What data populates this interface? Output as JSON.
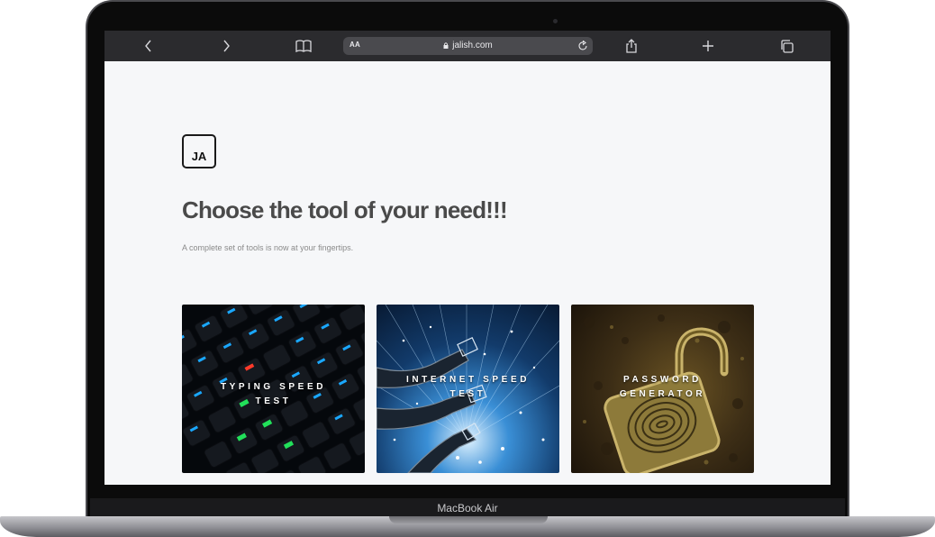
{
  "device": {
    "label": "MacBook Air"
  },
  "browser": {
    "text_size_button": "AA",
    "url": "jalish.com",
    "icons": {
      "back": "chevron-left-icon",
      "forward": "chevron-right-icon",
      "bookmarks": "book-icon",
      "reload": "reload-icon",
      "share": "share-icon",
      "new_tab": "plus-icon",
      "tabs": "tabs-icon"
    }
  },
  "page": {
    "logo_text": "JA",
    "headline": "Choose the tool of your need!!!",
    "subline": "A complete set of tools is now at your fingertips.",
    "tools": [
      {
        "label": "TYPING SPEED TEST"
      },
      {
        "label": "INTERNET SPEED TEST"
      },
      {
        "label": "PASSWORD GENERATOR"
      }
    ]
  },
  "colors": {
    "page_background": "#f6f7f9",
    "toolbar_background": "#2b2b2e",
    "headline_text": "#4a4a4a",
    "subline_text": "#8a8a8a"
  }
}
